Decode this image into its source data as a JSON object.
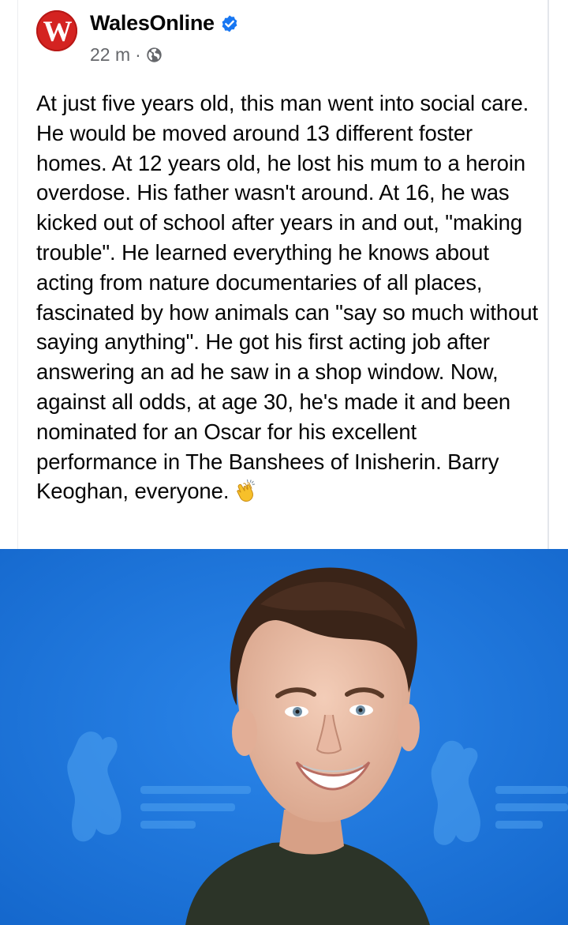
{
  "post": {
    "logo_letter": "W",
    "author": "WalesOnline",
    "time": "22 m",
    "separator": "·",
    "verified_icon": "verified-badge-icon",
    "audience_icon": "globe-icon",
    "text": "At just five years old, this man went into social care. He would be moved around 13 different foster homes. At 12 years old, he lost his mum to a heroin overdose. His father wasn't around. At 16, he was kicked out of school after years in and out, \"making trouble\". He learned everything he knows about acting from nature documentaries of all places, fascinated by how animals can \"say so much without saying anything\". He got his first acting job after answering an ad he saw in a shop window. Now, against all odds, at age 30, he's made it and been nominated for an Oscar for his excellent performance in The Banshees of Inisherin. Barry Keoghan, everyone.",
    "emoji_icon": "clapping-hands-icon"
  },
  "colors": {
    "logo_red": "#d42321",
    "verified_blue": "#1877f2",
    "meta_gray": "#65676b",
    "photo_backdrop_blue": "#1e73d6"
  }
}
